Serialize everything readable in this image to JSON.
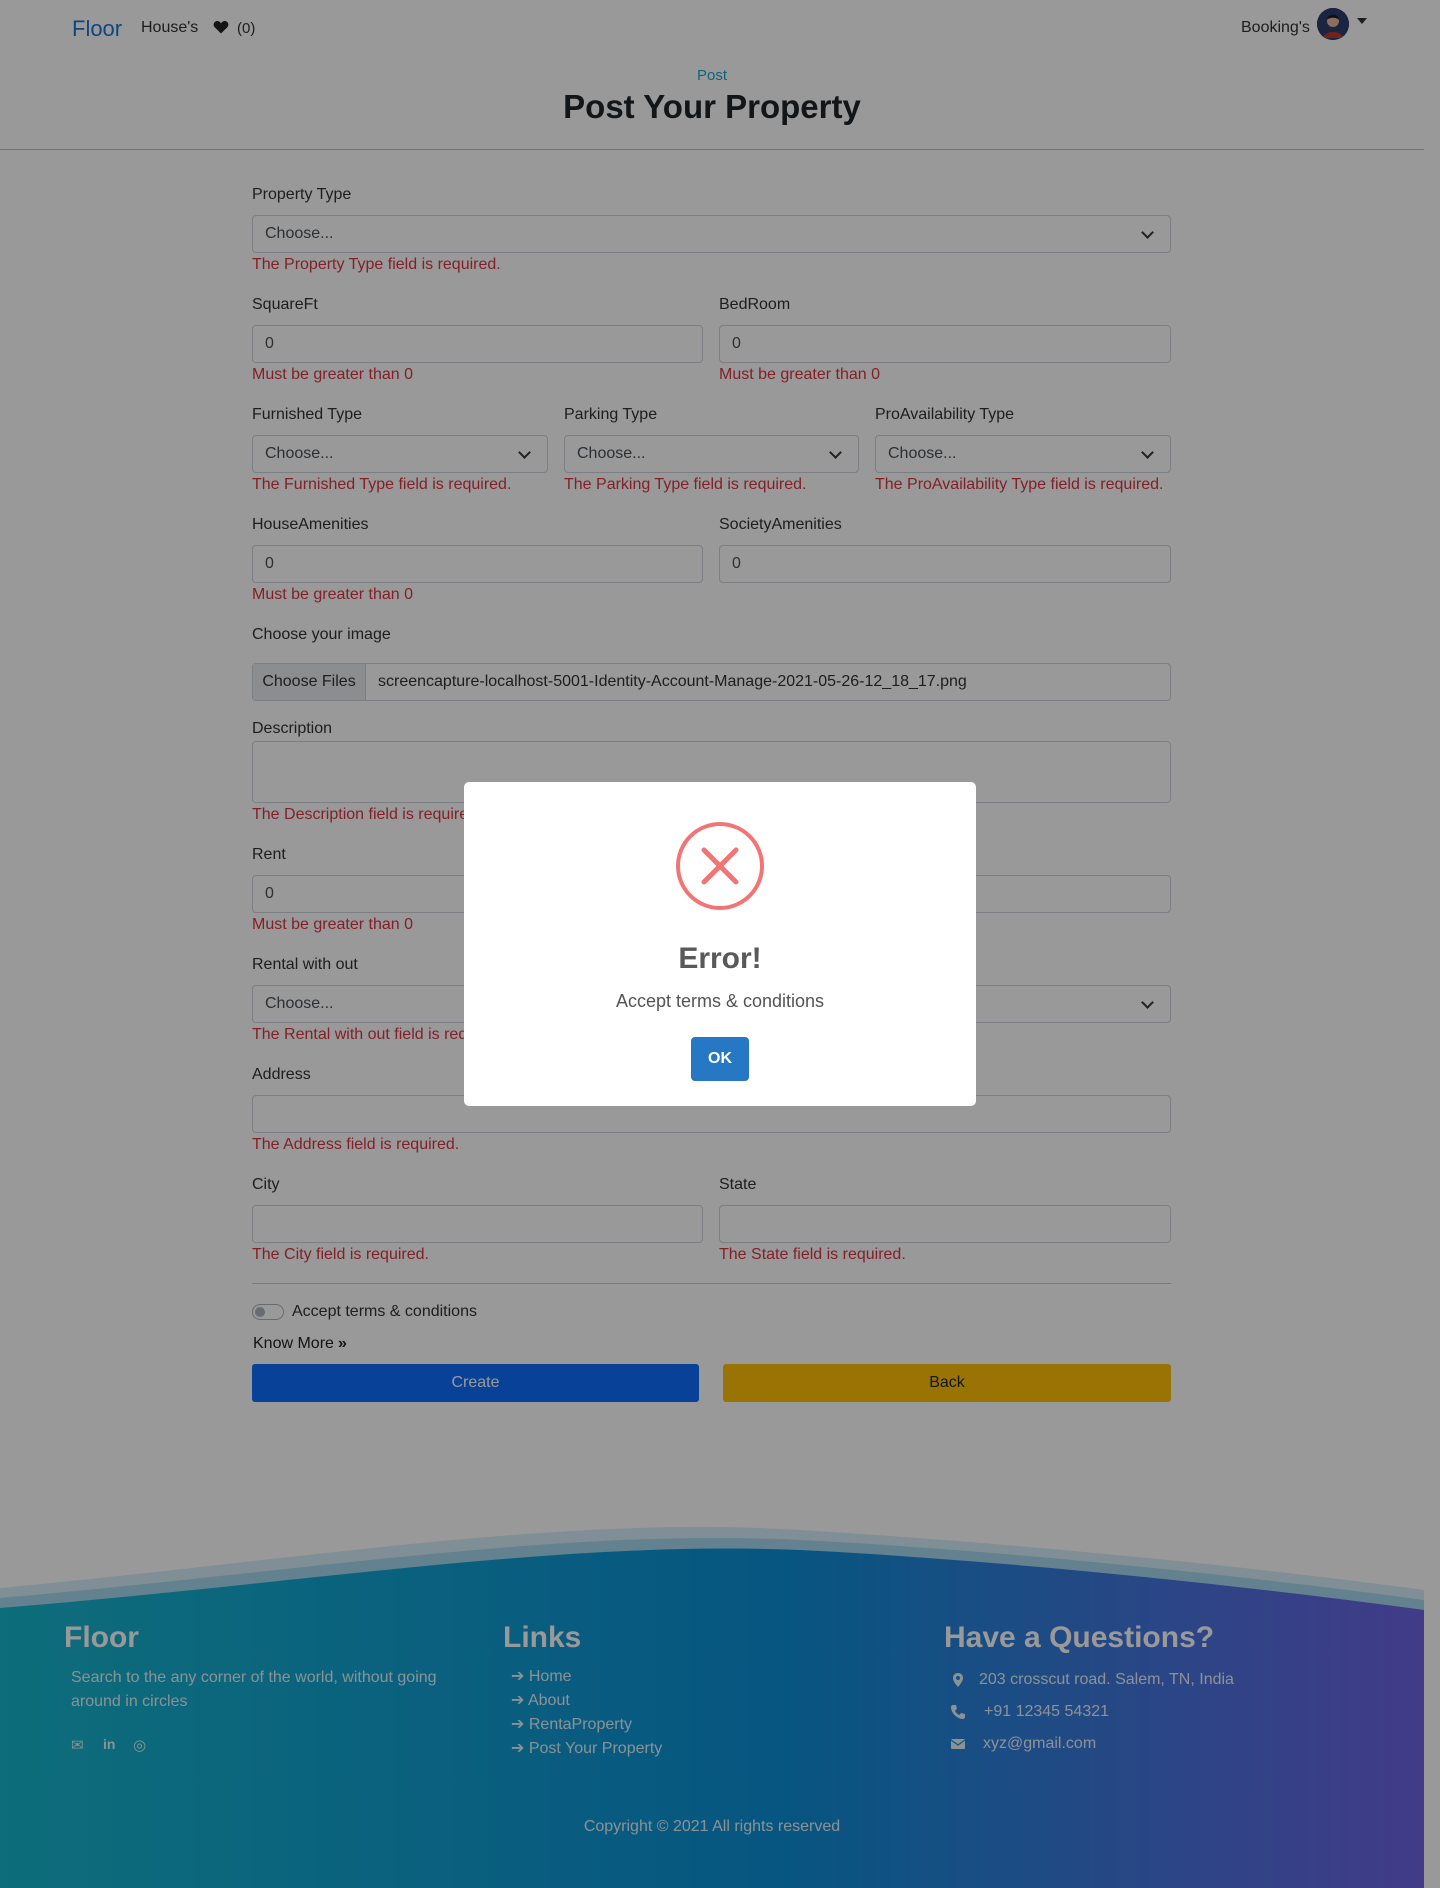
{
  "navbar": {
    "brand": "Floor",
    "houses": "House's",
    "wishlist_count": "(0)",
    "bookings": "Booking's"
  },
  "header": {
    "breadcrumb": "Post",
    "title": "Post Your Property"
  },
  "form": {
    "property_type": {
      "label": "Property Type",
      "value": "Choose...",
      "error": "The Property Type field is required."
    },
    "squareft": {
      "label": "SquareFt",
      "value": "0",
      "error": "Must be greater than 0"
    },
    "bedroom": {
      "label": "BedRoom",
      "value": "0",
      "error": "Must be greater than 0"
    },
    "furnished_type": {
      "label": "Furnished Type",
      "value": "Choose...",
      "error": "The Furnished Type field is required."
    },
    "parking_type": {
      "label": "Parking Type",
      "value": "Choose...",
      "error": "The Parking Type field is required."
    },
    "proavailability_type": {
      "label": "ProAvailability Type",
      "value": "Choose...",
      "error": "The ProAvailability Type field is required."
    },
    "house_amenities": {
      "label": "HouseAmenities",
      "value": "0",
      "error": "Must be greater than 0"
    },
    "society_amenities": {
      "label": "SocietyAmenities",
      "value": "0"
    },
    "image": {
      "label": "Choose your image",
      "button": "Choose Files",
      "filename": "screencapture-localhost-5001-Identity-Account-Manage-2021-05-26-12_18_17.png"
    },
    "description": {
      "label": "Description",
      "error": "The Description field is require"
    },
    "rent": {
      "label": "Rent",
      "value": "0",
      "error": "Must be greater than 0"
    },
    "rental_without": {
      "label": "Rental with out",
      "value": "Choose...",
      "error": "The Rental with out field is req"
    },
    "address": {
      "label": "Address",
      "error": "The Address field is required."
    },
    "city": {
      "label": "City",
      "error": "The City field is required."
    },
    "state": {
      "label": "State",
      "error": "The State field is required."
    },
    "accept_terms": "Accept terms & conditions",
    "know_more": "Know More",
    "create_button": "Create",
    "back_button": "Back"
  },
  "footer": {
    "brand": "Floor",
    "description": "Search to the any corner of the world, without going around in circles",
    "links_title": "Links",
    "links": [
      "Home",
      "About",
      "RentaProperty",
      "Post Your Property"
    ],
    "contact_title": "Have a Questions?",
    "address": "203 crosscut road. Salem, TN, India",
    "phone": "+91 12345 54321",
    "email": "xyz@gmail.com",
    "copyright": "Copyright © 2021 All rights reserved",
    "social_icons": [
      "envelope-icon",
      "linkedin-icon",
      "instagram-icon"
    ]
  },
  "modal": {
    "title": "Error!",
    "message": "Accept terms & conditions",
    "ok_button": "OK"
  },
  "colors": {
    "brand_blue": "#1b74d8",
    "error_red": "#dc3545",
    "create_blue": "#0d6efd",
    "back_yellow": "#ffc107",
    "modal_ok": "#2778c4",
    "error_icon": "#f27474"
  }
}
